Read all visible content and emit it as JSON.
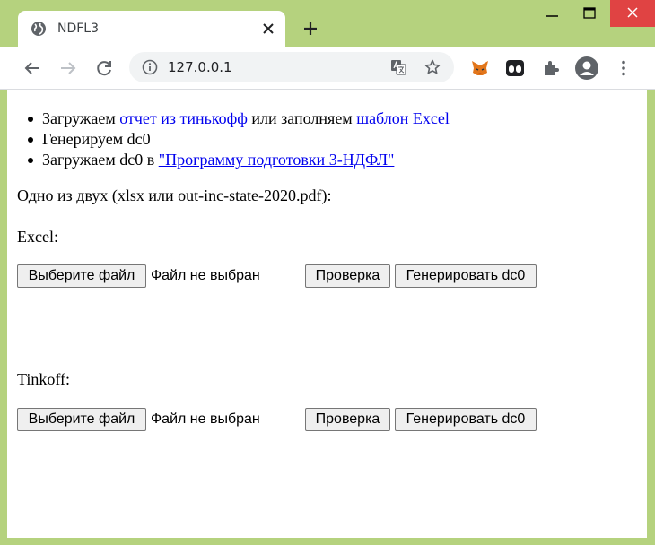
{
  "browser": {
    "tab": {
      "title": "NDFL3",
      "favicon": "globe-icon",
      "close": "close-icon"
    },
    "new_tab": "plus-icon",
    "window_controls": [
      "minimize-icon",
      "maximize-icon",
      "close-icon"
    ],
    "address_bar": {
      "url": "127.0.0.1"
    },
    "colors": {
      "frame": "#b5d27e",
      "close_hover": "#e04343",
      "link": "#0000ee"
    }
  },
  "page": {
    "steps": [
      {
        "prefix": "Загружаем ",
        "link1": "отчет из тинькофф",
        "middle": " или заполняем ",
        "link2": "шаблон Excel"
      },
      {
        "text": "Генерируем dc0"
      },
      {
        "prefix": "Загружаем dc0 в ",
        "link": "\"Программу подготовки 3-НДФЛ\""
      }
    ],
    "intro": "Одно из двух (xlsx или out-inc-state-2020.pdf):",
    "sections": [
      {
        "label": "Excel:",
        "choose_file": "Выберите файл",
        "file_status": "Файл не выбран",
        "check": "Проверка",
        "generate": "Генерировать dc0"
      },
      {
        "label": "Tinkoff:",
        "choose_file": "Выберите файл",
        "file_status": "Файл не выбран",
        "check": "Проверка",
        "generate": "Генерировать dc0"
      }
    ]
  }
}
